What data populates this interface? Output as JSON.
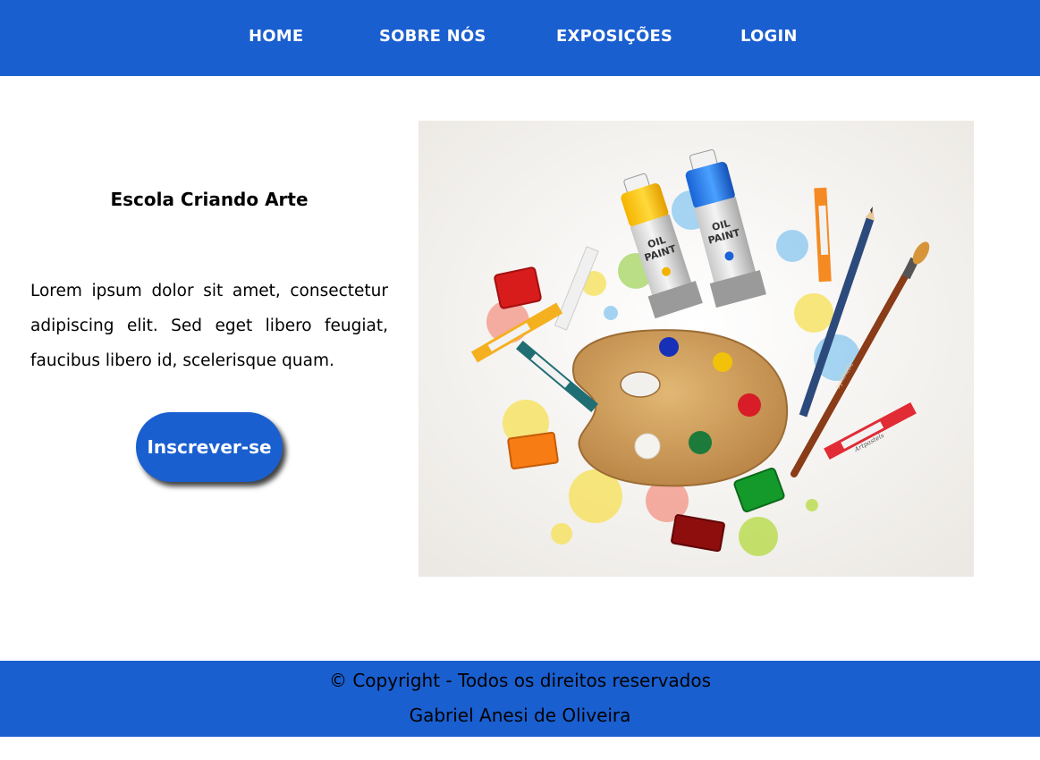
{
  "nav": {
    "items": [
      {
        "label": "HOME"
      },
      {
        "label": "SOBRE NÓS"
      },
      {
        "label": "EXPOSIÇÕES"
      },
      {
        "label": "LOGIN"
      }
    ]
  },
  "hero": {
    "title": "Escola Criando Arte",
    "text": "Lorem ipsum dolor sit amet, consectetur adipiscing elit. Sed eget libero feugiat, faucibus libero id, scelerisque quam.",
    "cta_label": "Inscrever-se"
  },
  "illustration": {
    "tube_left_label_1": "OIL",
    "tube_left_label_2": "PAINT",
    "tube_right_label_1": "OIL",
    "tube_right_label_2": "PAINT",
    "brush_label": "synthetic",
    "pastel_label": "Artpastels"
  },
  "footer": {
    "copyright": "© Copyright - Todos os direitos reservados",
    "author": "Gabriel Anesi de Oliveira"
  },
  "colors": {
    "brand_blue": "#1a5fd0",
    "text": "#000000",
    "nav_text": "#ffffff"
  }
}
